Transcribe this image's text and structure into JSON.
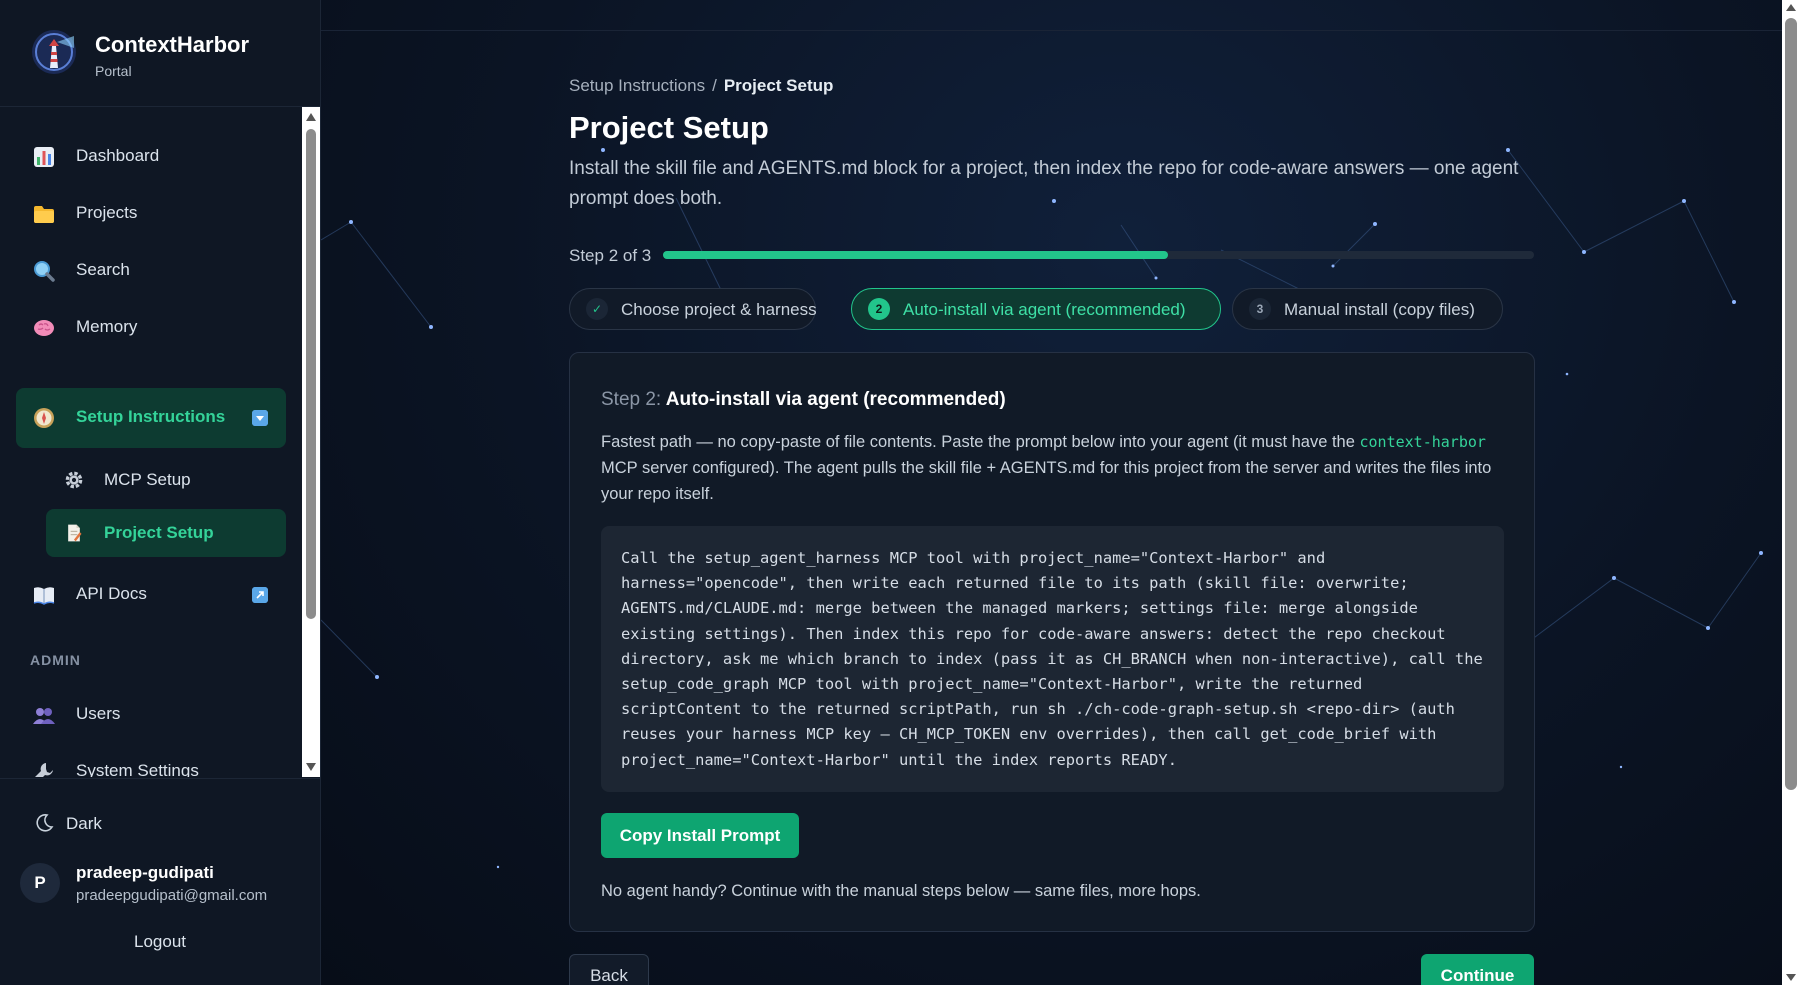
{
  "app": {
    "name": "ContextHarbor",
    "subtitle": "Portal"
  },
  "sidebar": {
    "items": [
      {
        "label": "Dashboard",
        "icon": "bar-chart-icon"
      },
      {
        "label": "Projects",
        "icon": "folder-icon"
      },
      {
        "label": "Search",
        "icon": "magnifier-icon"
      },
      {
        "label": "Memory",
        "icon": "brain-icon"
      },
      {
        "label": "Setup Instructions",
        "icon": "compass-icon",
        "active": true,
        "expanded": true
      },
      {
        "label": "API Docs",
        "icon": "book-icon",
        "external": true
      }
    ],
    "sub_items": [
      {
        "label": "MCP Setup",
        "icon": "gear-icon"
      },
      {
        "label": "Project Setup",
        "icon": "document-icon",
        "active": true
      }
    ],
    "admin_label": "ADMIN",
    "admin_items": [
      {
        "label": "Users",
        "icon": "users-icon"
      },
      {
        "label": "System Settings",
        "icon": "wrench-icon"
      }
    ],
    "theme_label": "Dark",
    "user": {
      "initial": "P",
      "name": "pradeep-gudipati",
      "email": "pradeepgudipati@gmail.com"
    },
    "logout_label": "Logout"
  },
  "breadcrumb": {
    "parent": "Setup Instructions",
    "separator": "/",
    "current": "Project Setup"
  },
  "page": {
    "title": "Project Setup",
    "description": "Install the skill file and AGENTS.md block for a project, then index the repo for code-aware answers — one agent prompt does both."
  },
  "progress": {
    "label": "Step 2 of 3",
    "fraction": 0.58
  },
  "steps": [
    {
      "marker": "✓",
      "label": "Choose project & harness",
      "state": "done"
    },
    {
      "marker": "2",
      "label": "Auto-install via agent (recommended)",
      "state": "active"
    },
    {
      "marker": "3",
      "label": "Manual install (copy files)",
      "state": "pending"
    }
  ],
  "card": {
    "title_prefix": "Step 2:",
    "title": "Auto-install via agent (recommended)",
    "desc_before": "Fastest path — no copy-paste of file contents. Paste the prompt below into your agent (it must have the ",
    "desc_code": "context-harbor",
    "desc_after": " MCP server configured). The agent pulls the skill file + AGENTS.md for this project from the server and writes the files into your repo itself.",
    "prompt": "Call the setup_agent_harness MCP tool with project_name=\"Context-Harbor\" and harness=\"opencode\", then write each returned file to its path (skill file: overwrite; AGENTS.md/CLAUDE.md: merge between the managed markers; settings file: merge alongside existing settings). Then index this repo for code-aware answers: detect the repo checkout directory, ask me which branch to index (pass it as CH_BRANCH when non-interactive), call the setup_code_graph MCP tool with project_name=\"Context-Harbor\", write the returned scriptContent to the returned scriptPath, run sh ./ch-code-graph-setup.sh <repo-dir> (auth reuses your harness MCP key — CH_MCP_TOKEN env overrides), then call get_code_brief with project_name=\"Context-Harbor\" until the index reports READY.",
    "copy_label": "Copy Install Prompt",
    "footer": "No agent handy? Continue with the manual steps below — same files, more hops."
  },
  "nav_buttons": {
    "back": "Back",
    "continue": "Continue"
  },
  "colors": {
    "accent": "#22c58b",
    "accent_dark": "#0d3b31",
    "button": "#0ea571"
  }
}
